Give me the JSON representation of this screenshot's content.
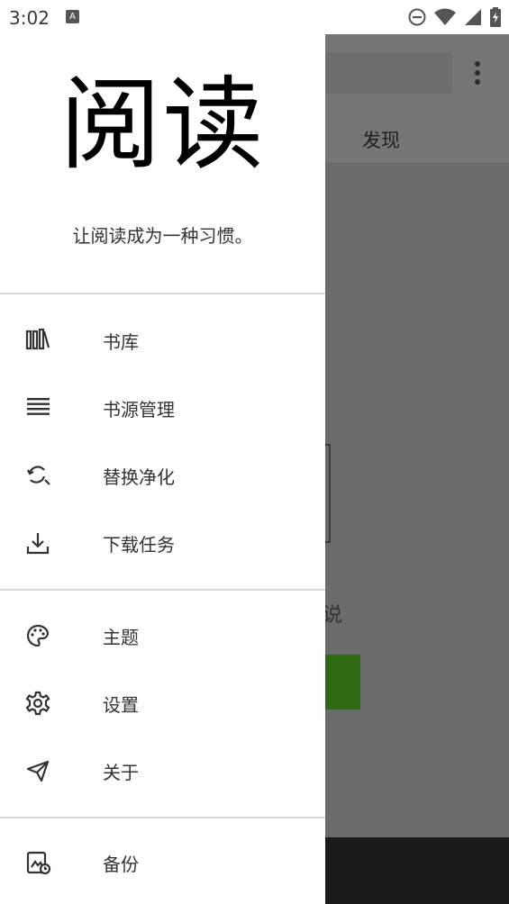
{
  "status_bar": {
    "time": "3:02",
    "notification_icon_letter": "A",
    "icons": [
      "dnd-icon",
      "wifi-icon",
      "signal-icon",
      "battery-icon"
    ]
  },
  "background_app": {
    "tab_discover": "发现",
    "partial_text": "说",
    "accent_color": "#2e6a14"
  },
  "drawer": {
    "logo_text": "阅读",
    "slogan": "让阅读成为一种习惯。",
    "sections": [
      [
        {
          "label": "书库",
          "icon": "bookshelf-icon"
        },
        {
          "label": "书源管理",
          "icon": "list-icon"
        },
        {
          "label": "替换净化",
          "icon": "replace-search-icon"
        },
        {
          "label": "下载任务",
          "icon": "download-icon"
        }
      ],
      [
        {
          "label": "主题",
          "icon": "palette-icon"
        },
        {
          "label": "设置",
          "icon": "gear-icon"
        },
        {
          "label": "关于",
          "icon": "send-icon"
        }
      ],
      [
        {
          "label": "备份",
          "icon": "backup-icon"
        }
      ]
    ]
  }
}
